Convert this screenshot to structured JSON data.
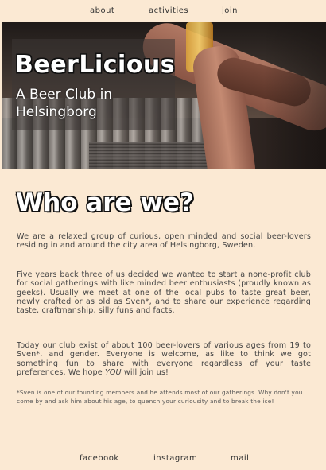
{
  "nav": {
    "about": "about",
    "activities": "activities",
    "join": "join"
  },
  "hero": {
    "brand": "BeerLicious",
    "subtitle": "A Beer Club in Helsingborg"
  },
  "main": {
    "heading": "Who are we?",
    "paragraph1": "We are a relaxed group of curious, open minded and social beer-lovers residing in and around the city area of Helsingborg, Sweden.",
    "paragraph2": "Five years back three of us decided we wanted to start a none-profit club for social gatherings with like minded beer enthusiasts (proudly known as geeks). Usually we meet at one of the local pubs to taste great beer, newly crafted or as old as Sven*, and to share our experience regarding taste, craftmanship, silly funs and facts.",
    "paragraph3_before": "Today our club exist of about 100 beer-lovers of various ages from 19 to Sven*, and gender. Everyone is welcome, as like to think we got something fun to share with everyone regardless of your taste preferences. We hope ",
    "paragraph3_em": "YOU",
    "paragraph3_after": " will join us!",
    "note": "*Sven is one of our founding members and he attends most of our gatherings. Why don't you come by and ask him about his age, to quench your curiousity and to break the ice!"
  },
  "footer": {
    "facebook": "facebook",
    "instagram": "instagram",
    "mail": "mail"
  },
  "colors": {
    "background": "#fbe9d3",
    "text": "#444444"
  }
}
